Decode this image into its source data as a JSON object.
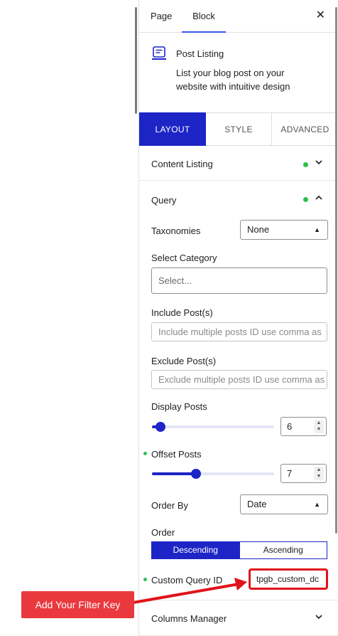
{
  "top_tabs": {
    "page": "Page",
    "block": "Block",
    "close": "✕"
  },
  "block": {
    "title": "Post Listing",
    "description": "List your blog post on your website with intuitive design"
  },
  "tabs": {
    "layout": "LAYOUT",
    "style": "STYLE",
    "advanced": "ADVANCED"
  },
  "sections": {
    "content_listing": "Content Listing",
    "query": "Query",
    "columns_manager": "Columns Manager"
  },
  "query": {
    "taxonomies_label": "Taxonomies",
    "taxonomies_value": "None",
    "select_category_label": "Select Category",
    "select_category_value": "Select...",
    "include_label": "Include Post(s)",
    "include_placeholder": "Include multiple posts ID use comma as",
    "exclude_label": "Exclude Post(s)",
    "exclude_placeholder": "Exclude multiple posts ID use comma as",
    "display_posts_label": "Display Posts",
    "display_posts_value": "6",
    "offset_posts_label": "Offset Posts",
    "offset_posts_value": "7",
    "order_by_label": "Order By",
    "order_by_value": "Date",
    "order_label": "Order",
    "order_desc": "Descending",
    "order_asc": "Ascending",
    "custom_query_label": "Custom Query ID",
    "custom_query_value": "tpgb_custom_dc"
  },
  "sliders": {
    "display_posts_fraction": 0.07,
    "offset_posts_fraction": 0.36
  },
  "annotation": {
    "callout": "Add Your Filter Key"
  },
  "colors": {
    "accent": "#1d25c6",
    "status_dot": "#2ec14a",
    "highlight": "#e1131a",
    "callout_bg": "#e9393f"
  }
}
